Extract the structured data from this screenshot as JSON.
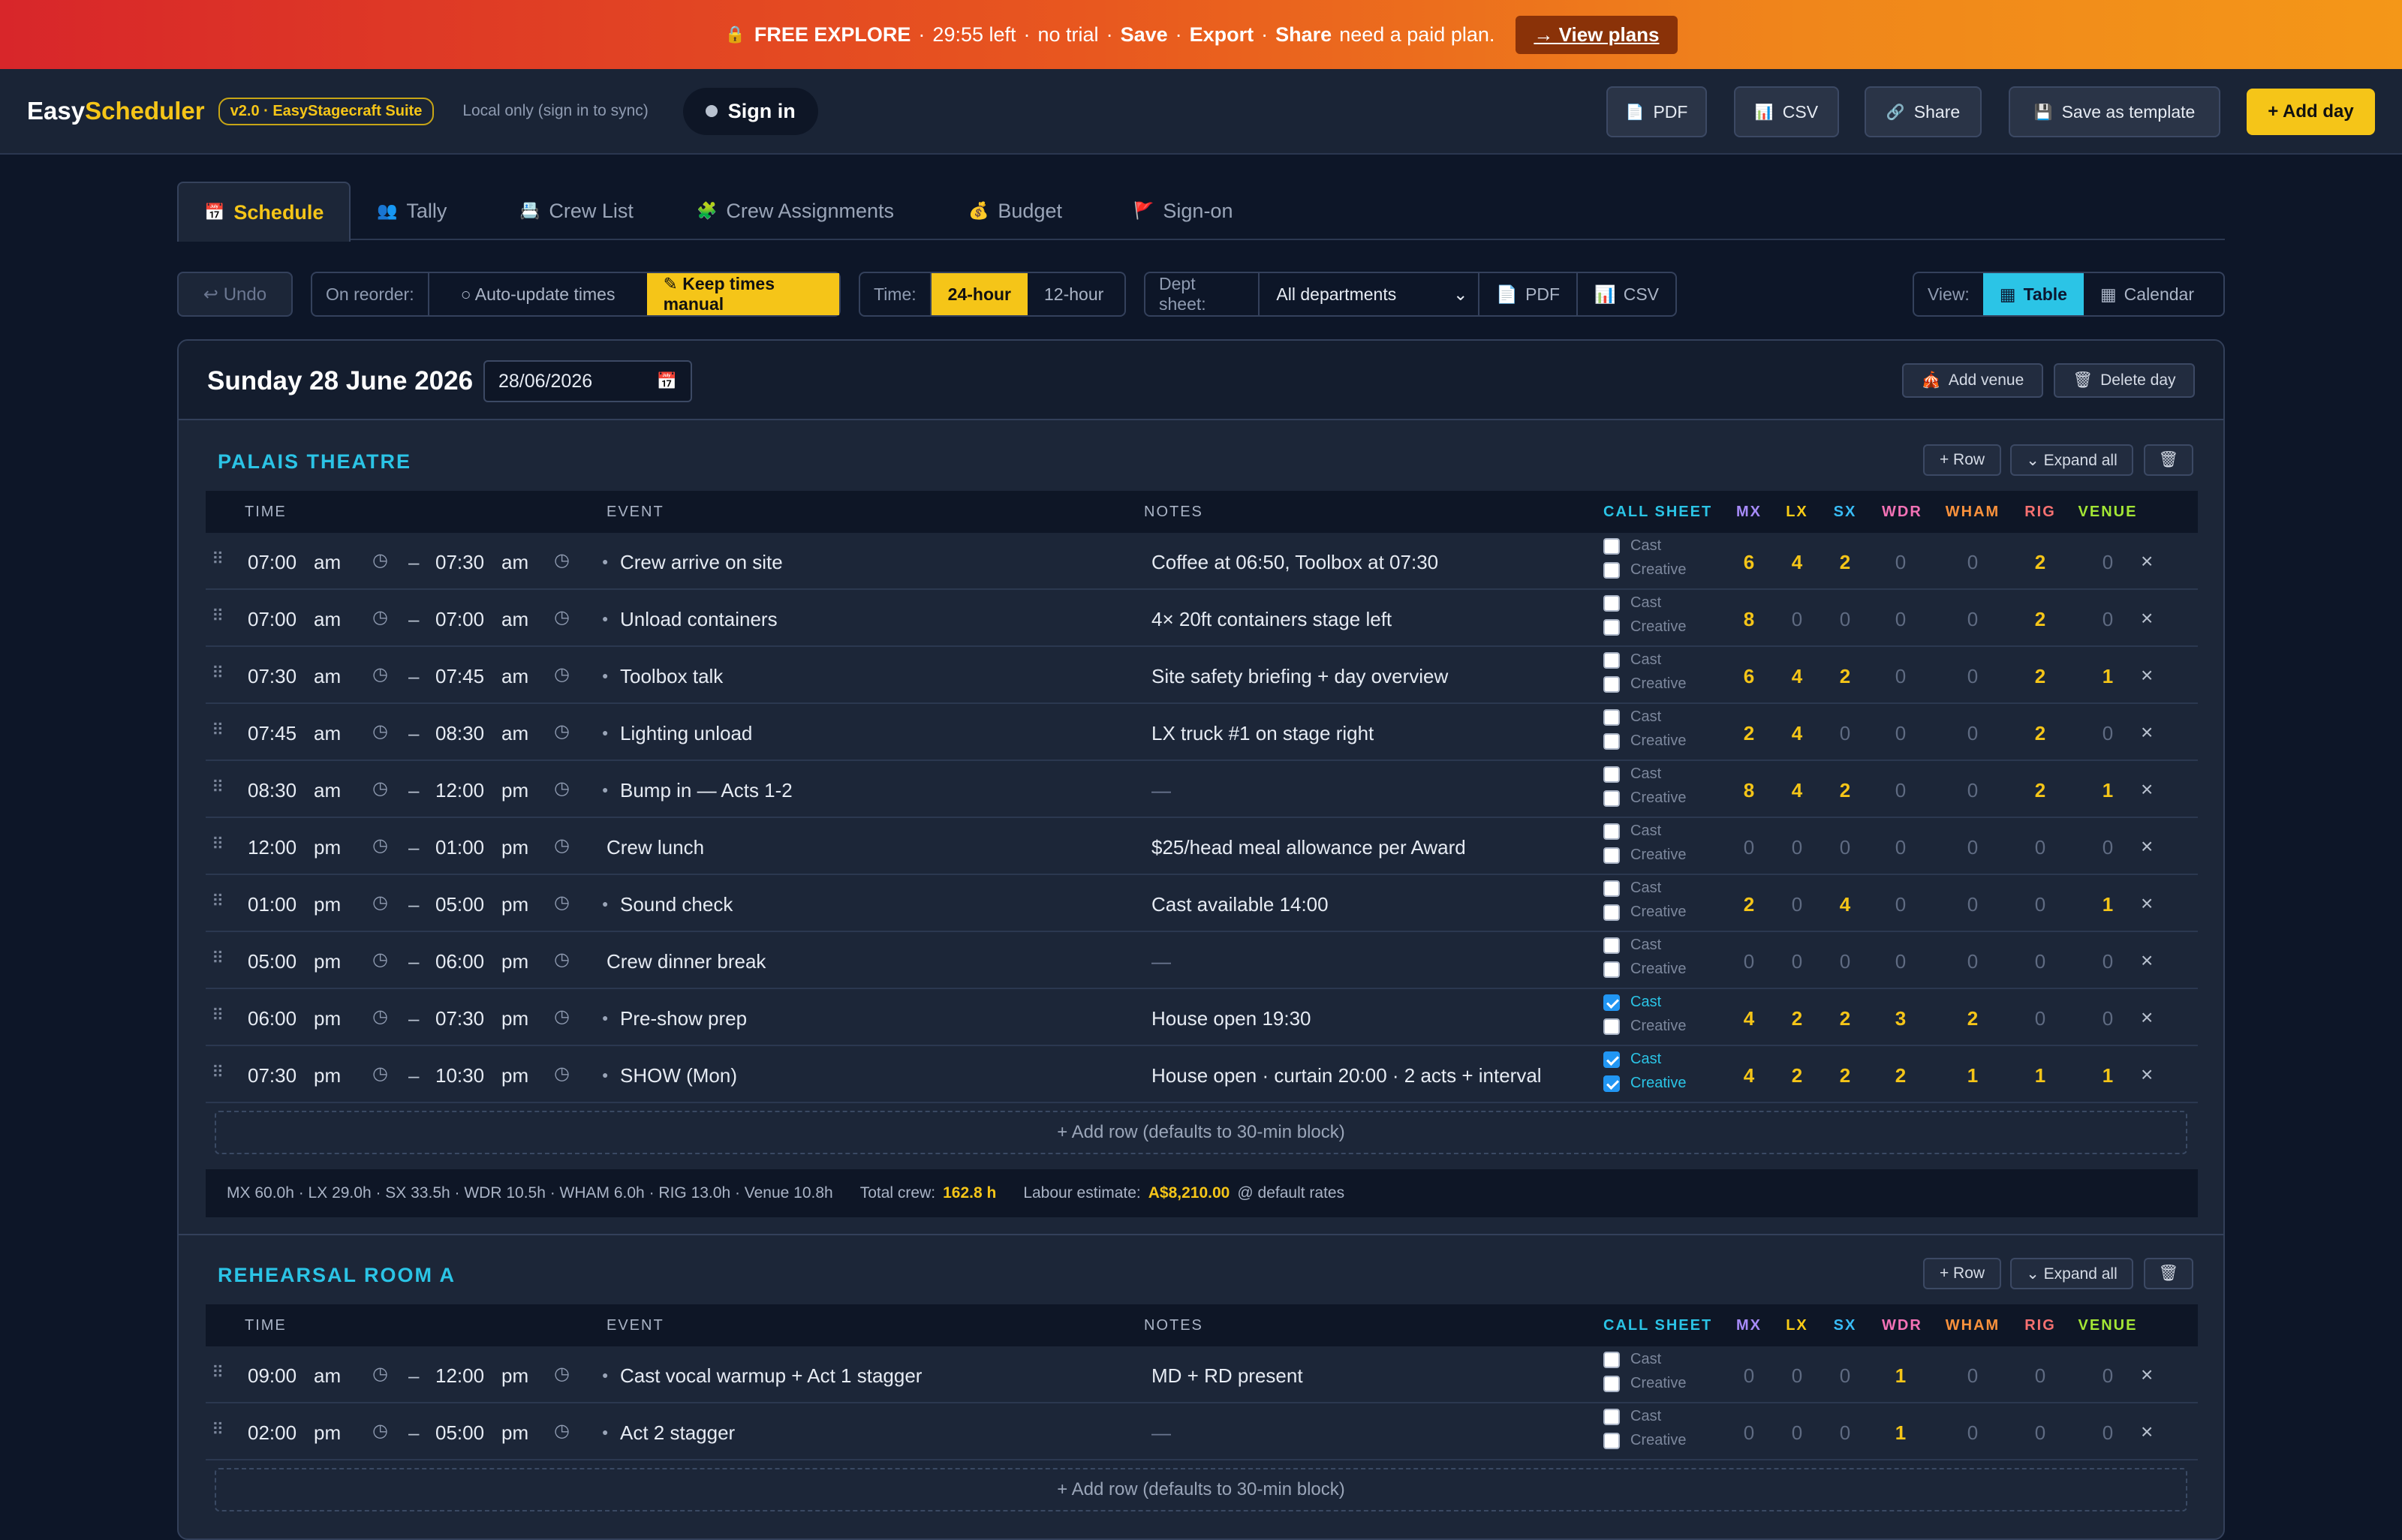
{
  "promo": {
    "lock_icon": "lock-icon",
    "title": "FREE EXPLORE",
    "timer": "29:55 left",
    "trial": "no trial",
    "save": "Save",
    "export": "Export",
    "share": "Share",
    "tail": "need a paid plan.",
    "cta": "→ View plans"
  },
  "app": {
    "brand_a": "Easy",
    "brand_b": "Scheduler",
    "version": "v2.0 · EasyStagecraft Suite",
    "local": "Local only (sign in to sync)",
    "signin": "Sign in"
  },
  "toolbar": {
    "pdf": "PDF",
    "csv": "CSV",
    "share": "Share",
    "save_template": "Save as template",
    "add_day": "+ Add day"
  },
  "tabs": [
    {
      "label": "Schedule",
      "icon": "calendar-icon"
    },
    {
      "label": "Tally",
      "icon": "people-icon"
    },
    {
      "label": "Crew List",
      "icon": "clipboard-icon"
    },
    {
      "label": "Crew Assignments",
      "icon": "puzzle-icon"
    },
    {
      "label": "Budget",
      "icon": "money-bag-icon"
    },
    {
      "label": "Sign-on",
      "icon": "flag-icon"
    }
  ],
  "controls": {
    "undo": "↩ Undo",
    "reorder_label": "On reorder:",
    "auto": "○ Auto-update times",
    "manual": "✎ Keep times manual",
    "time_label": "Time:",
    "h24": "24-hour",
    "h12": "12-hour",
    "dept_label": "Dept sheet:",
    "dept_value": "All departments",
    "pdf": "PDF",
    "csv": "CSV",
    "view_label": "View:",
    "table": "Table",
    "calendar": "Calendar"
  },
  "day": {
    "title": "Sunday 28 June 2026",
    "date": "28/06/2026",
    "add_venue": "Add venue",
    "delete_day": "Delete day"
  },
  "venue_actions": {
    "row": "+ Row",
    "expand": "⌄ Expand all"
  },
  "headers": {
    "time": "TIME",
    "event": "EVENT",
    "notes": "NOTES",
    "callsheet": "CALL SHEET",
    "mx": "MX",
    "lx": "LX",
    "sx": "SX",
    "wdr": "WDR",
    "wham": "WHAM",
    "rig": "RIG",
    "venue": "VENUE"
  },
  "checkbox_labels": {
    "cast": "Cast",
    "creative": "Creative"
  },
  "venues": [
    {
      "name": "PALAIS THEATRE",
      "add_row": "+ Add row (defaults to 30-min block)",
      "rows": [
        {
          "start": "07:00",
          "sp": "am",
          "end": "07:30",
          "ep": "am",
          "event": "Crew arrive on site",
          "notes": "Coffee at 06:50, Toolbox at 07:30",
          "cast": false,
          "creative": false,
          "mx": "6",
          "lx": "4",
          "sx": "2",
          "wdr": "0",
          "wham": "0",
          "rig": "2",
          "venue": "0"
        },
        {
          "start": "07:00",
          "sp": "am",
          "end": "07:00",
          "ep": "am",
          "event": "Unload containers",
          "notes": "4× 20ft containers stage left",
          "cast": false,
          "creative": false,
          "mx": "8",
          "lx": "0",
          "sx": "0",
          "wdr": "0",
          "wham": "0",
          "rig": "2",
          "venue": "0"
        },
        {
          "start": "07:30",
          "sp": "am",
          "end": "07:45",
          "ep": "am",
          "event": "Toolbox talk",
          "notes": "Site safety briefing + day overview",
          "cast": false,
          "creative": false,
          "mx": "6",
          "lx": "4",
          "sx": "2",
          "wdr": "0",
          "wham": "0",
          "rig": "2",
          "venue": "1"
        },
        {
          "start": "07:45",
          "sp": "am",
          "end": "08:30",
          "ep": "am",
          "event": "Lighting unload",
          "notes": "LX truck #1 on stage right",
          "cast": false,
          "creative": false,
          "mx": "2",
          "lx": "4",
          "sx": "0",
          "wdr": "0",
          "wham": "0",
          "rig": "2",
          "venue": "0"
        },
        {
          "start": "08:30",
          "sp": "am",
          "end": "12:00",
          "ep": "pm",
          "event": "Bump in — Acts 1-2",
          "notes": "—",
          "cast": false,
          "creative": false,
          "mx": "8",
          "lx": "4",
          "sx": "2",
          "wdr": "0",
          "wham": "0",
          "rig": "2",
          "venue": "1"
        },
        {
          "start": "12:00",
          "sp": "pm",
          "end": "01:00",
          "ep": "pm",
          "event": "Crew lunch",
          "notes": "$25/head meal allowance per Award",
          "cast": false,
          "creative": false,
          "mx": "0",
          "lx": "0",
          "sx": "0",
          "wdr": "0",
          "wham": "0",
          "rig": "0",
          "venue": "0",
          "nobullet": true
        },
        {
          "start": "01:00",
          "sp": "pm",
          "end": "05:00",
          "ep": "pm",
          "event": "Sound check",
          "notes": "Cast available 14:00",
          "cast": false,
          "creative": false,
          "mx": "2",
          "lx": "0",
          "sx": "4",
          "wdr": "0",
          "wham": "0",
          "rig": "0",
          "venue": "1"
        },
        {
          "start": "05:00",
          "sp": "pm",
          "end": "06:00",
          "ep": "pm",
          "event": "Crew dinner break",
          "notes": "—",
          "cast": false,
          "creative": false,
          "mx": "0",
          "lx": "0",
          "sx": "0",
          "wdr": "0",
          "wham": "0",
          "rig": "0",
          "venue": "0",
          "nobullet": true
        },
        {
          "start": "06:00",
          "sp": "pm",
          "end": "07:30",
          "ep": "pm",
          "event": "Pre-show prep",
          "notes": "House open 19:30",
          "cast": true,
          "creative": false,
          "mx": "4",
          "lx": "2",
          "sx": "2",
          "wdr": "3",
          "wham": "2",
          "rig": "0",
          "venue": "0"
        },
        {
          "start": "07:30",
          "sp": "pm",
          "end": "10:30",
          "ep": "pm",
          "event": "SHOW (Mon)",
          "notes": "House open · curtain 20:00 · 2 acts + interval",
          "cast": true,
          "creative": true,
          "mx": "4",
          "lx": "2",
          "sx": "2",
          "wdr": "2",
          "wham": "1",
          "rig": "1",
          "venue": "1"
        }
      ],
      "summary": {
        "hours": "MX 60.0h · LX 29.0h · SX 33.5h · WDR 10.5h · WHAM 6.0h · RIG 13.0h · Venue 10.8h",
        "total_label": "Total crew:",
        "total": "162.8 h",
        "labour_label": "Labour estimate:",
        "labour": "A$8,210.00",
        "labour_tail": "@ default rates"
      }
    },
    {
      "name": "REHEARSAL ROOM A",
      "add_row": "+ Add row (defaults to 30-min block)",
      "rows": [
        {
          "start": "09:00",
          "sp": "am",
          "end": "12:00",
          "ep": "pm",
          "event": "Cast vocal warmup + Act 1 stagger",
          "notes": "MD + RD present",
          "cast": false,
          "creative": false,
          "mx": "0",
          "lx": "0",
          "sx": "0",
          "wdr": "1",
          "wham": "0",
          "rig": "0",
          "venue": "0"
        },
        {
          "start": "02:00",
          "sp": "pm",
          "end": "05:00",
          "ep": "pm",
          "event": "Act 2 stagger",
          "notes": "—",
          "cast": false,
          "creative": false,
          "mx": "0",
          "lx": "0",
          "sx": "0",
          "wdr": "1",
          "wham": "0",
          "rig": "0",
          "venue": "0"
        }
      ]
    }
  ],
  "colors": {
    "accent": "#f5c518",
    "cyan": "#2bc4e6",
    "mx": "#a78bfa",
    "lx": "#facc15",
    "sx": "#38bdf8",
    "wdr": "#f472b6",
    "wham": "#fb923c",
    "rig": "#f87171",
    "venue": "#a3e635"
  }
}
